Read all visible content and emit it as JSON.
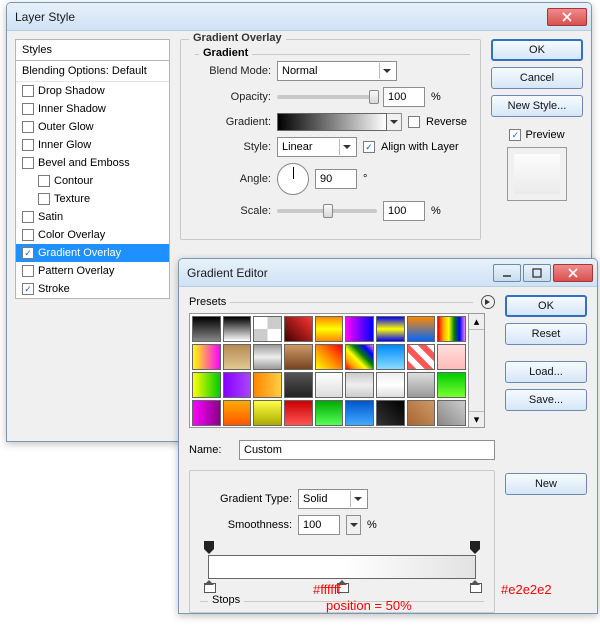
{
  "layerStyle": {
    "title": "Layer Style",
    "stylesHeader": "Styles",
    "blendingHeader": "Blending Options: Default",
    "items": [
      {
        "label": "Drop Shadow",
        "checked": false
      },
      {
        "label": "Inner Shadow",
        "checked": false
      },
      {
        "label": "Outer Glow",
        "checked": false
      },
      {
        "label": "Inner Glow",
        "checked": false
      },
      {
        "label": "Bevel and Emboss",
        "checked": false
      },
      {
        "label": "Contour",
        "checked": false,
        "child": true
      },
      {
        "label": "Texture",
        "checked": false,
        "child": true
      },
      {
        "label": "Satin",
        "checked": false
      },
      {
        "label": "Color Overlay",
        "checked": false
      },
      {
        "label": "Gradient Overlay",
        "checked": true,
        "active": true
      },
      {
        "label": "Pattern Overlay",
        "checked": false
      },
      {
        "label": "Stroke",
        "checked": true
      }
    ],
    "section": {
      "title": "Gradient Overlay",
      "subTitle": "Gradient",
      "blendModeLabel": "Blend Mode:",
      "blendMode": "Normal",
      "opacityLabel": "Opacity:",
      "opacity": "100",
      "percent": "%",
      "gradientLabel": "Gradient:",
      "reverseLabel": "Reverse",
      "styleLabel": "Style:",
      "style": "Linear",
      "alignLabel": "Align with Layer",
      "angleLabel": "Angle:",
      "angle": "90",
      "degree": "°",
      "scaleLabel": "Scale:",
      "scale": "100"
    },
    "buttons": {
      "ok": "OK",
      "cancel": "Cancel",
      "newStyle": "New Style...",
      "previewLabel": "Preview"
    }
  },
  "gradientEditor": {
    "title": "Gradient Editor",
    "presetsLabel": "Presets",
    "nameLabel": "Name:",
    "name": "Custom",
    "newBtn": "New",
    "typeLabel": "Gradient Type:",
    "type": "Solid",
    "smoothLabel": "Smoothness:",
    "smooth": "100",
    "percent": "%",
    "stopsLabel": "Stops",
    "buttons": {
      "ok": "OK",
      "reset": "Reset",
      "load": "Load...",
      "save": "Save..."
    },
    "presets": [
      "linear-gradient(#000,#888)",
      "linear-gradient(#000,#fff)",
      "repeating-conic-gradient(#ccc 0 25%,#fff 0 50%)",
      "linear-gradient(45deg,#400,#f33)",
      "linear-gradient(#f80,#ff0,#f80)",
      "linear-gradient(90deg,#f0f,#00f)",
      "linear-gradient(#00f,#ff0,#00f)",
      "linear-gradient(#f80,#06f)",
      "linear-gradient(90deg,red,orange,yellow,green,blue,violet)",
      "linear-gradient(90deg,#ff0,#f0f)",
      "linear-gradient(#b58b55,#e2c892)",
      "linear-gradient(#999,#eee,#999)",
      "linear-gradient(#c96,#742)",
      "linear-gradient(45deg,#ff0,#f80,#f00)",
      "linear-gradient(45deg,red,orange,yellow,green,blue,violet)",
      "linear-gradient(#08f,#8df)",
      "repeating-linear-gradient(45deg,#f55 0 6px,#fff 6px 12px)",
      "linear-gradient(#fdd,#fbb)",
      "linear-gradient(90deg,#ff0,#0c0)",
      "linear-gradient(90deg,#80f,#a4f)",
      "linear-gradient(90deg,#f80,#fc4)",
      "linear-gradient(#555,#222)",
      "linear-gradient(#fff,#ddd)",
      "linear-gradient(#ccc,#eee,#ccc)",
      "linear-gradient(#eee,#fff,#ddd)",
      "linear-gradient(#ddd,#999)",
      "linear-gradient(#0c0,#7f3)",
      "linear-gradient(90deg,#f0f,#808)",
      "linear-gradient(#fa0,#f50)",
      "linear-gradient(#ff4,#aa0)",
      "linear-gradient(#c00,#f55)",
      "linear-gradient(#0a0,#5f5)",
      "linear-gradient(#05c,#4af)",
      "linear-gradient(45deg,#333,#000)",
      "linear-gradient(45deg,#a63,#c96)",
      "linear-gradient(45deg,#888,#ccc)"
    ]
  },
  "annotations": {
    "left": "#ffffff",
    "pos": "position = 50%",
    "right": "#e2e2e2"
  }
}
